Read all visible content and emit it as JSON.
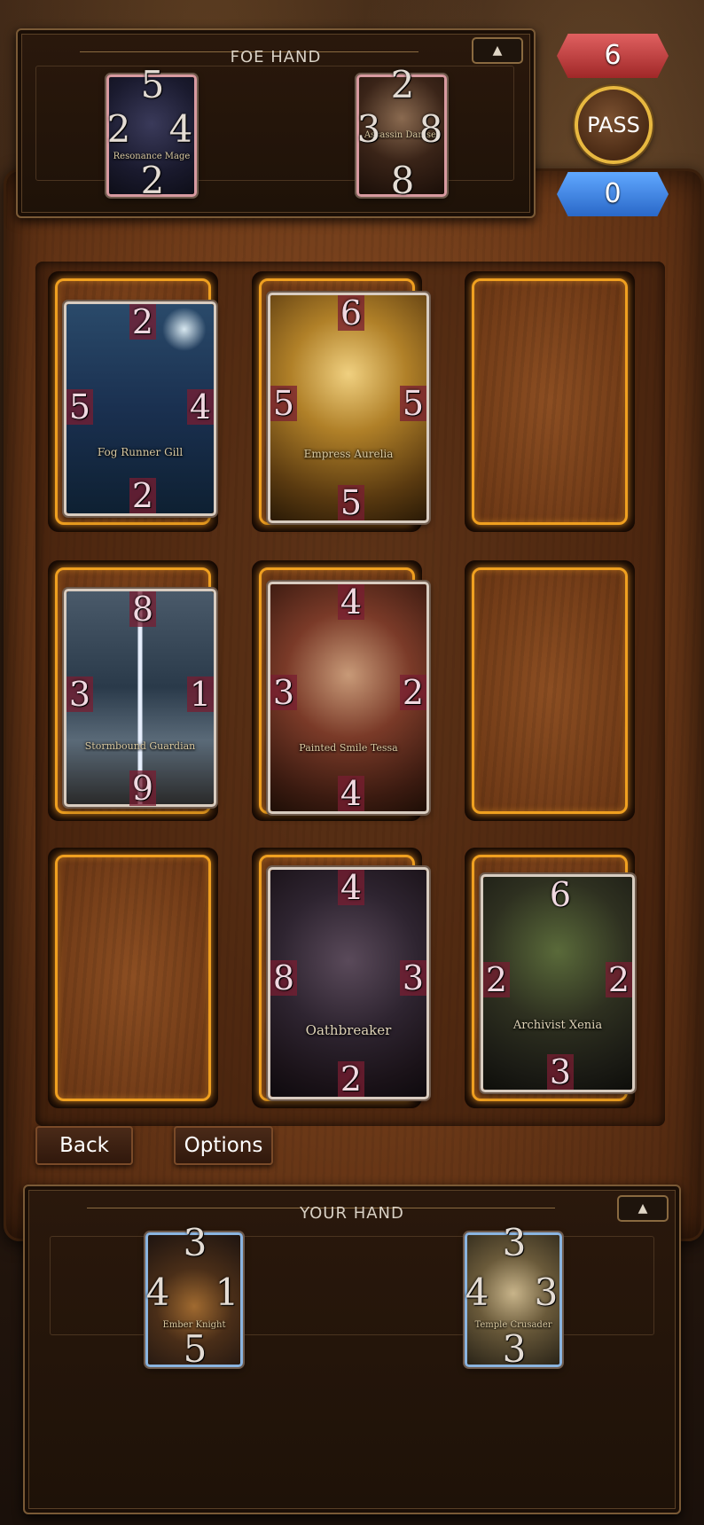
{
  "foe_hand": {
    "title": "FOE HAND",
    "collapse_icon": "▲",
    "cards": [
      {
        "name": "Resonance Mage",
        "top": "5",
        "left": "2",
        "right": "4",
        "bottom": "2"
      },
      {
        "name": "Assassin Damsel",
        "top": "2",
        "left": "3",
        "right": "8",
        "bottom": "8"
      }
    ]
  },
  "score": {
    "foe": "6",
    "player": "0",
    "pass_label": "PASS"
  },
  "board": {
    "cards": [
      {
        "name": "Fog Runner Gill",
        "top": "2",
        "left": "5",
        "right": "4",
        "bottom": "2"
      },
      {
        "name": "Empress Aurelia",
        "top": "6",
        "left": "5",
        "right": "5",
        "bottom": "5"
      },
      {
        "name": "Stormbound Guardian",
        "top": "8",
        "left": "3",
        "right": "1",
        "bottom": "9"
      },
      {
        "name": "Painted Smile Tessa",
        "top": "4",
        "left": "3",
        "right": "2",
        "bottom": "4"
      },
      {
        "name": "Oathbreaker",
        "top": "4",
        "left": "8",
        "right": "3",
        "bottom": "2"
      },
      {
        "name": "Archivist Xenia",
        "top": "6",
        "left": "2",
        "right": "2",
        "bottom": "3"
      }
    ]
  },
  "menu": {
    "back_label": "Back",
    "options_label": "Options"
  },
  "your_hand": {
    "title": "YOUR HAND",
    "collapse_icon": "▲",
    "cards": [
      {
        "name": "Ember Knight",
        "top": "3",
        "left": "4",
        "right": "1",
        "bottom": "5"
      },
      {
        "name": "Temple Crusader",
        "top": "3",
        "left": "4",
        "right": "3",
        "bottom": "3"
      }
    ]
  },
  "colors": {
    "slot_glow": "#f0a020",
    "foe_accent": "#e06060",
    "player_accent": "#60a8ff"
  }
}
